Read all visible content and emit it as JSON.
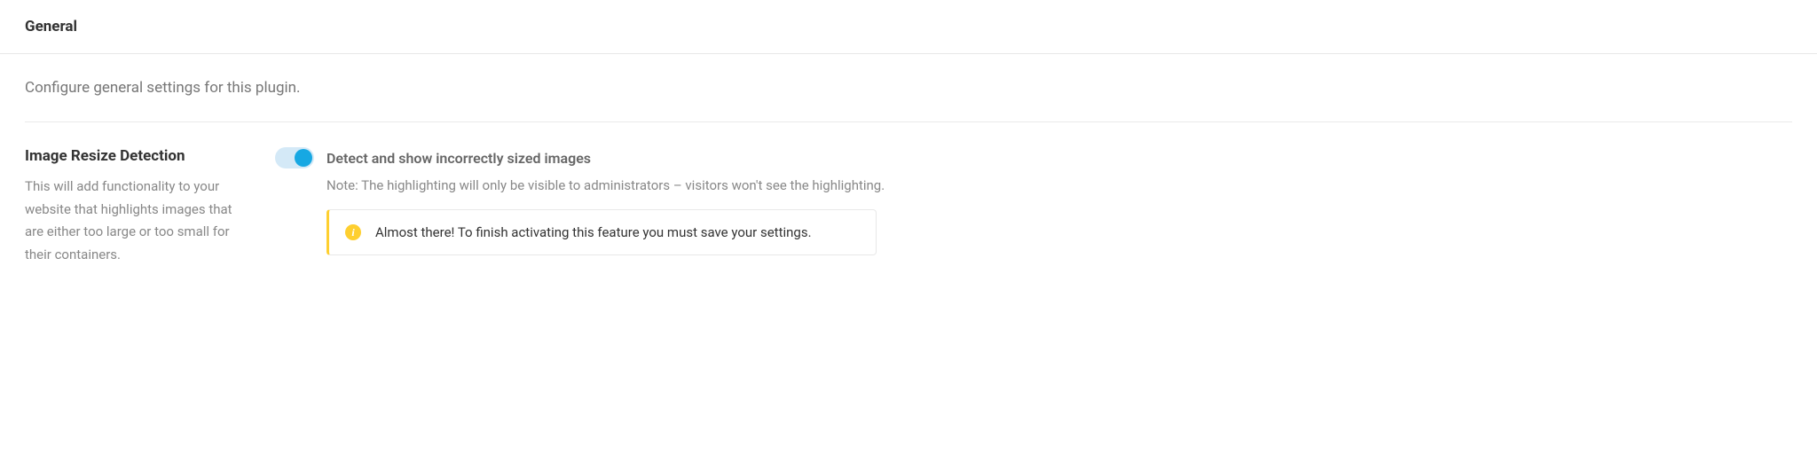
{
  "header": {
    "title": "General"
  },
  "intro": "Configure general settings for this plugin.",
  "setting": {
    "title": "Image Resize Detection",
    "description": "This will add functionality to your website that highlights images that are either too large or too small for their containers.",
    "toggle_label": "Detect and show incorrectly sized images",
    "note": "Note: The highlighting will only be visible to administrators – visitors won't see the highlighting.",
    "alert": "Almost there! To finish activating this feature you must save your settings."
  }
}
